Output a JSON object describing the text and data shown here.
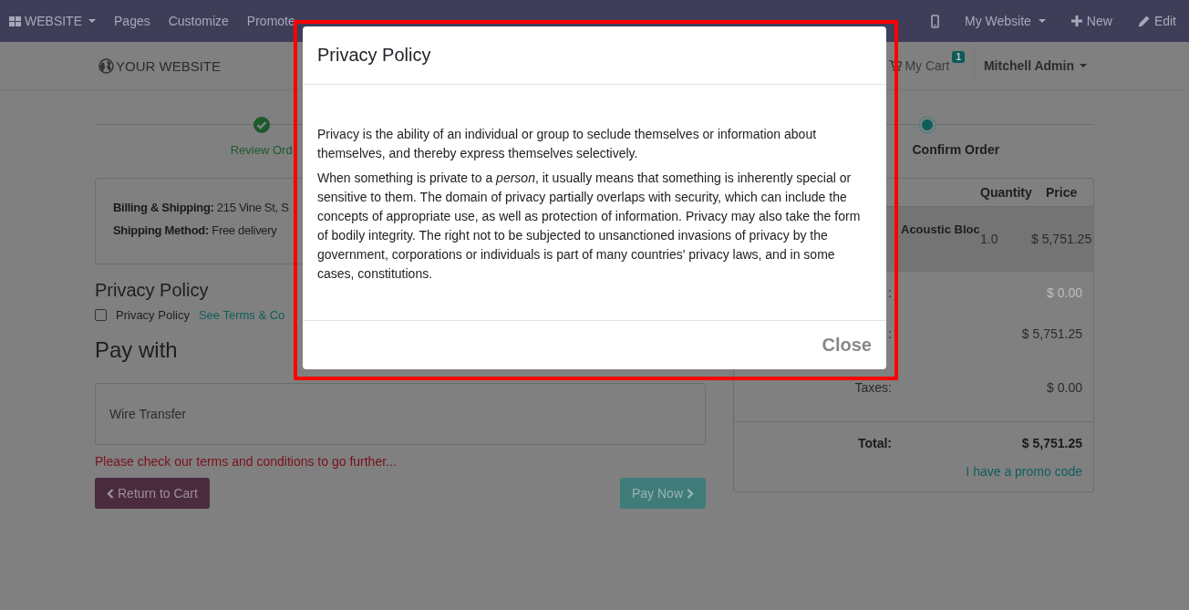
{
  "top_bar": {
    "left": [
      {
        "label": "WEBSITE",
        "kind": "apps"
      },
      {
        "label": "Pages",
        "kind": "plain"
      },
      {
        "label": "Customize",
        "kind": "plain"
      },
      {
        "label": "Promote",
        "kind": "plain"
      }
    ],
    "right": [
      {
        "kind": "device"
      },
      {
        "label": "My Website",
        "kind": "dropdown"
      },
      {
        "label": "New",
        "kind": "new"
      },
      {
        "label": "Edit",
        "kind": "edit"
      }
    ]
  },
  "header": {
    "logo": "YOUR WEBSITE",
    "cart": {
      "label": "My Cart",
      "count": "1"
    },
    "user": "Mitchell Admin"
  },
  "steps": [
    {
      "label": "Review Ord",
      "completed": true
    },
    {
      "label": "Confirm Order",
      "completed": false
    }
  ],
  "address": [
    "**Billing & Shipping:** 215 Vine St, S",
    "**Shipping Method:** Free delivery"
  ],
  "privacy": {
    "heading": "Privacy Policy",
    "checkbox": {
      "label": "Privacy Policy",
      "checked": false
    },
    "link": "See Terms & Co"
  },
  "payment": {
    "heading": "Pay with",
    "methods": [
      {
        "label": "Wire Transfer"
      }
    ],
    "error": "Please check our terms and conditions to go further...",
    "back_button": "Return to Cart",
    "pay_button": {
      "label": "Pay Now",
      "disabled": true
    }
  },
  "order_summary": {
    "columns": [
      "Quantity",
      "Price"
    ],
    "lines": [
      {
        "product": "Acoustic Bloc",
        "quantity": "1.0",
        "price": "$ 5,751.25"
      }
    ],
    "totals": [
      {
        "label": ":",
        "value": "$ 0.00",
        "muted": true
      },
      {
        "label": ":",
        "value": "$ 5,751.25",
        "muted": false
      },
      {
        "label": "Taxes:",
        "value": "$ 0.00",
        "muted": false
      }
    ],
    "total": {
      "label": "Total:",
      "value": "$ 5,751.25"
    },
    "promo_link": "I have a promo code"
  },
  "modal": {
    "title": "Privacy Policy",
    "paragraphs": [
      "Privacy is the ability of an individual or group to seclude themselves or information about themselves, and thereby express themselves selectively.",
      "When something is private to a *person*, it usually means that something is inherently special or sensitive to them. The domain of privacy partially overlaps with security, which can include the concepts of appropriate use, as well as protection of information. Privacy may also take the form of bodily integrity. The right not to be subjected to unsanctioned invasions of privacy by the government, corporations or individuals is part of many countries' privacy laws, and in some cases, constitutions."
    ],
    "close_button": "Close"
  }
}
